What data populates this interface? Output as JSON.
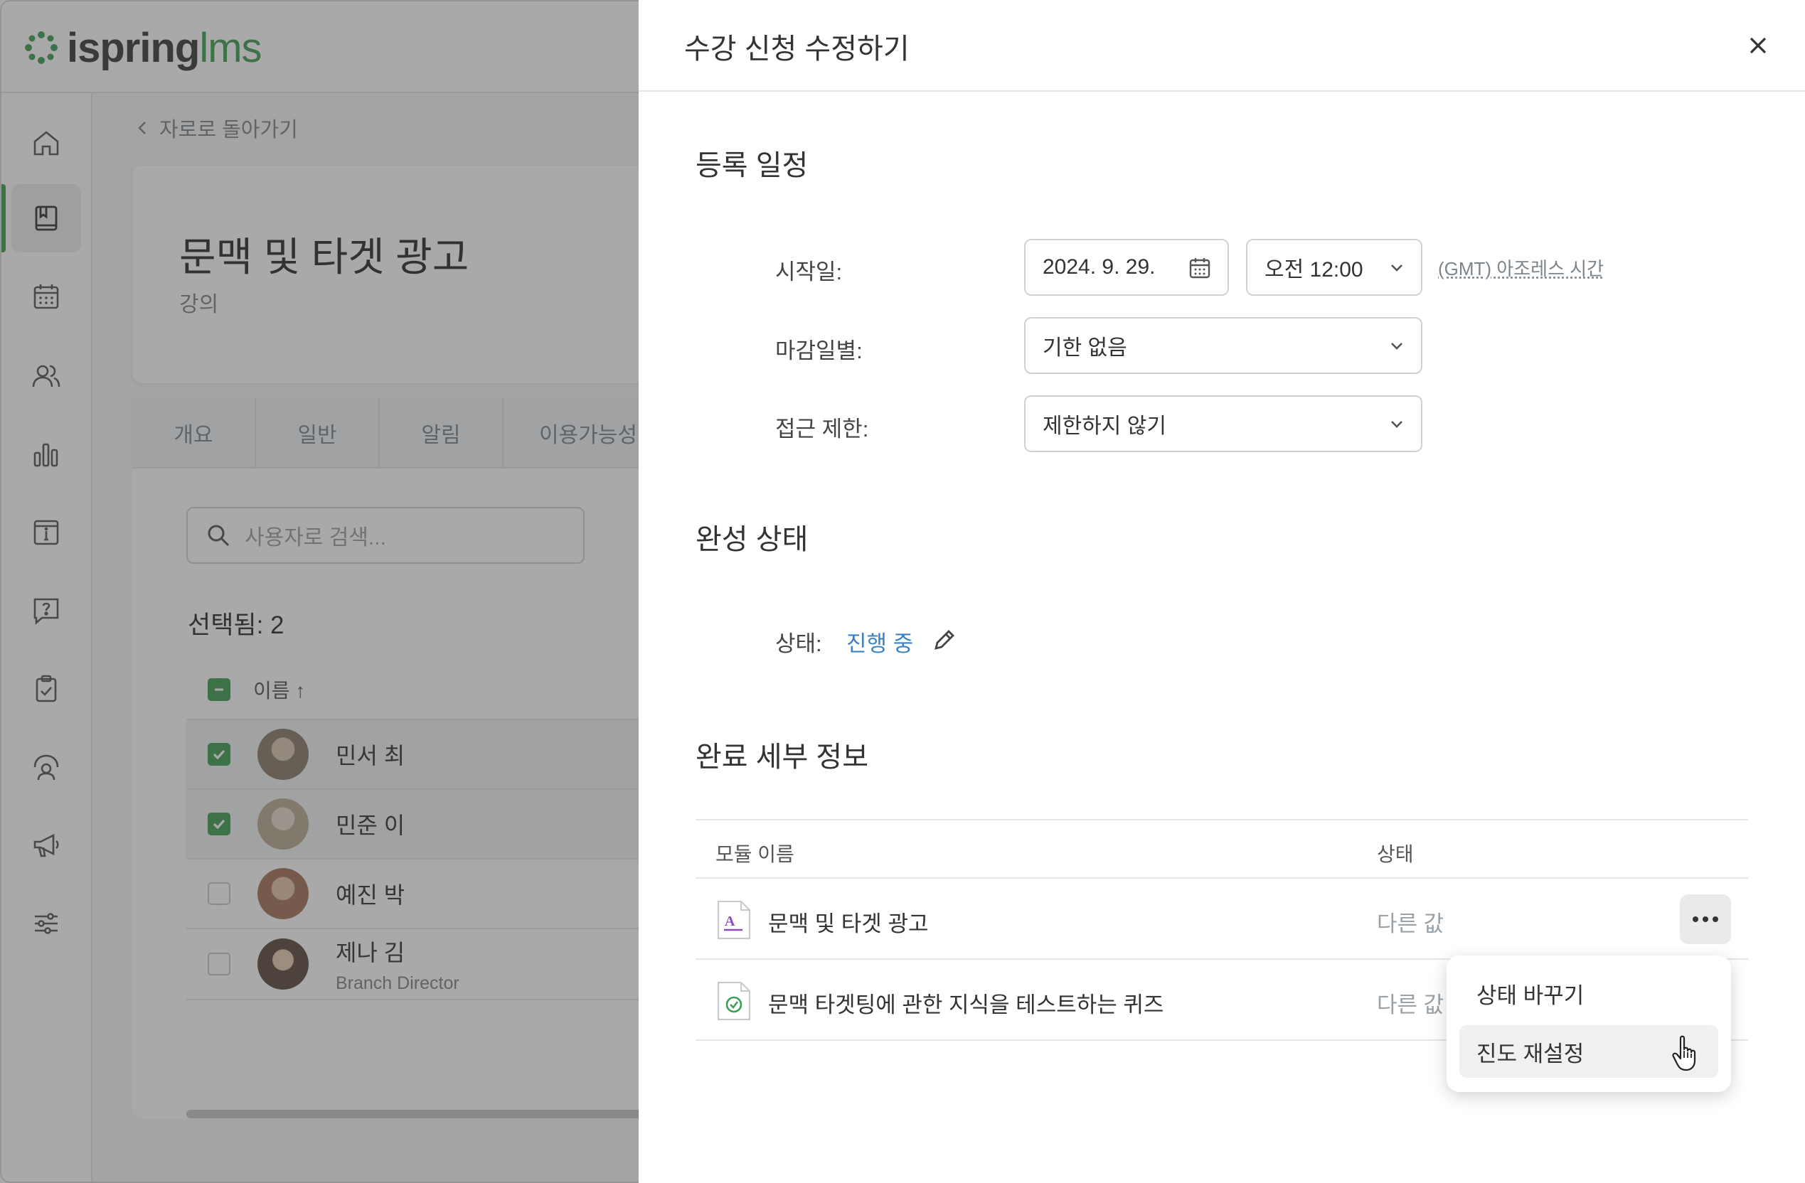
{
  "app": {
    "logo_text": "ispring",
    "logo_suffix": "lms",
    "back_link": "자로로 돌아가기",
    "course": {
      "title": "문맥 및 타겟 광고",
      "type": "강의"
    },
    "tabs": [
      "개요",
      "일반",
      "알림",
      "이용가능성"
    ],
    "search_placeholder": "사용자로 검색...",
    "selected_label": "선택됨: 2",
    "list_header_name": "이름",
    "users": [
      {
        "name": "민서 최",
        "role": "",
        "checked": true,
        "avatar_color": "#8a7a6a"
      },
      {
        "name": "민준 이",
        "role": "",
        "checked": true,
        "avatar_color": "#b9a994"
      },
      {
        "name": "예진 박",
        "role": "",
        "checked": false,
        "avatar_color": "#a5735a"
      },
      {
        "name": "제나 김",
        "role": "Branch Director",
        "checked": false,
        "avatar_color": "#5b4a3e"
      }
    ],
    "nav_icons": [
      "home-icon",
      "book-icon",
      "calendar-icon",
      "users-icon",
      "reports-icon",
      "info-icon",
      "help-icon",
      "clipboard-icon",
      "support-icon",
      "megaphone-icon",
      "settings-icon"
    ]
  },
  "drawer": {
    "title": "수강 신청 수정하기",
    "schedule": {
      "section_title": "등록 일정",
      "start_label": "시작일:",
      "start_date": "2024. 9. 29.",
      "start_time": "오전 12:00",
      "timezone": "(GMT) 아조레스 시간",
      "deadline_label": "마감일별:",
      "deadline_value": "기한 없음",
      "access_label": "접근 제한:",
      "access_value": "제한하지 않기"
    },
    "completion": {
      "section_title": "완성 상태",
      "status_label": "상태:",
      "status_value": "진행 중"
    },
    "details": {
      "section_title": "완료 세부 정보",
      "col_module": "모듈 이름",
      "col_status": "상태",
      "rows": [
        {
          "name": "문맥 및 타겟 광고",
          "status": "다른 값"
        },
        {
          "name": "문맥 타겟팅에 관한 지식을 테스트하는 퀴즈",
          "status": "다른 값"
        }
      ]
    },
    "menu": {
      "change_status": "상태 바꾸기",
      "reset_progress": "진도 재설정"
    }
  },
  "colors": {
    "accent_green": "#3f9e55",
    "link_blue": "#3b82c4"
  }
}
